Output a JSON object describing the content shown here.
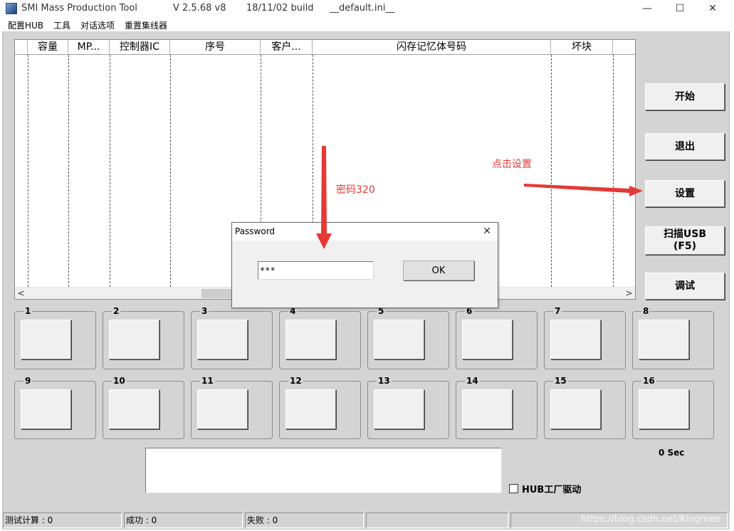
{
  "window": {
    "app_name": "SMI Mass Production Tool",
    "version": "V 2.5.68   v8",
    "build": "18/11/02 build",
    "config_file": "__default.ini__",
    "minimize": "—",
    "maximize": "☐",
    "close": "✕"
  },
  "menu": [
    "配置HUB",
    "工具",
    "对话选项",
    "重置集线器"
  ],
  "list": {
    "columns": [
      "",
      "容量",
      "MP...",
      "控制器IC",
      "序号",
      "客户...",
      "闪存记忆体号码",
      "坏块"
    ],
    "scroll_left": "<",
    "scroll_right": ">"
  },
  "side_buttons": {
    "start": "开始",
    "exit": "退出",
    "settings": "设置",
    "scan": "扫描USB\n(F5)",
    "debug": "调试"
  },
  "ports": [
    "1",
    "2",
    "3",
    "4",
    "5",
    "6",
    "7",
    "8",
    "9",
    "10",
    "11",
    "12",
    "13",
    "14",
    "15",
    "16"
  ],
  "timer": "0 Sec",
  "hub_driver": "HUB工厂驱动",
  "status": {
    "test_count": "测试计算 : 0",
    "success": "成功 : 0",
    "fail": "失败 : 0"
  },
  "watermark": "https://blog.csdn.net/Kingmee",
  "annotations": {
    "click_settings": "点击设置",
    "password_hint": "密码320",
    "color": "#e53935"
  },
  "dialog": {
    "title": "Password",
    "close": "✕",
    "input_value": "***",
    "ok": "OK"
  }
}
